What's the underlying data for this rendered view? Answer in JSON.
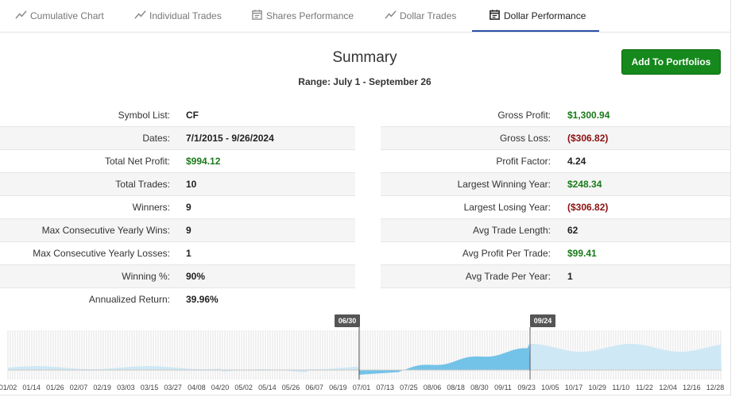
{
  "tabs": [
    {
      "label": "Cumulative Chart",
      "icon": "line-chart-icon"
    },
    {
      "label": "Individual Trades",
      "icon": "line-chart-icon"
    },
    {
      "label": "Shares Performance",
      "icon": "calendar-icon"
    },
    {
      "label": "Dollar Trades",
      "icon": "line-chart-icon"
    },
    {
      "label": "Dollar Performance",
      "icon": "calendar-icon",
      "active": true
    }
  ],
  "summary": {
    "title": "Summary",
    "range": "Range: July 1 - September 26",
    "add_button": "Add To Portfolios"
  },
  "left_stats": [
    {
      "label": "Symbol List:",
      "value": "CF"
    },
    {
      "label": "Dates:",
      "value": "7/1/2015 - 9/26/2024"
    },
    {
      "label": "Total Net Profit:",
      "value": "$994.12",
      "tone": "pos"
    },
    {
      "label": "Total Trades:",
      "value": "10"
    },
    {
      "label": "Winners:",
      "value": "9"
    },
    {
      "label": "Max Consecutive Yearly Wins:",
      "value": "9"
    },
    {
      "label": "Max Consecutive Yearly Losses:",
      "value": "1"
    },
    {
      "label": "Winning %:",
      "value": "90%"
    },
    {
      "label": "Annualized Return:",
      "value": "39.96%"
    }
  ],
  "right_stats": [
    {
      "label": "Gross Profit:",
      "value": "$1,300.94",
      "tone": "pos"
    },
    {
      "label": "Gross Loss:",
      "value": "($306.82)",
      "tone": "neg"
    },
    {
      "label": "Profit Factor:",
      "value": "4.24"
    },
    {
      "label": "Largest Winning Year:",
      "value": "$248.34",
      "tone": "pos"
    },
    {
      "label": "Largest Losing Year:",
      "value": "($306.82)",
      "tone": "neg"
    },
    {
      "label": "Avg Trade Length:",
      "value": "62"
    },
    {
      "label": "Avg Profit Per Trade:",
      "value": "$99.41",
      "tone": "pos"
    },
    {
      "label": "Avg Trade Per Year:",
      "value": "1"
    }
  ],
  "timeline": {
    "range_start_label": "06/30",
    "range_end_label": "09/24",
    "ticks": [
      "01/02",
      "01/14",
      "01/26",
      "02/07",
      "02/19",
      "03/03",
      "03/15",
      "03/27",
      "04/08",
      "04/20",
      "05/02",
      "05/14",
      "05/26",
      "06/07",
      "06/19",
      "07/01",
      "07/13",
      "07/25",
      "08/06",
      "08/18",
      "08/30",
      "09/11",
      "09/23",
      "10/05",
      "10/17",
      "10/29",
      "11/10",
      "11/22",
      "12/04",
      "12/16",
      "12/28"
    ],
    "colors": {
      "selected": "#73c2e8",
      "faded": "#cfe8f5",
      "marker": "#555555"
    }
  }
}
